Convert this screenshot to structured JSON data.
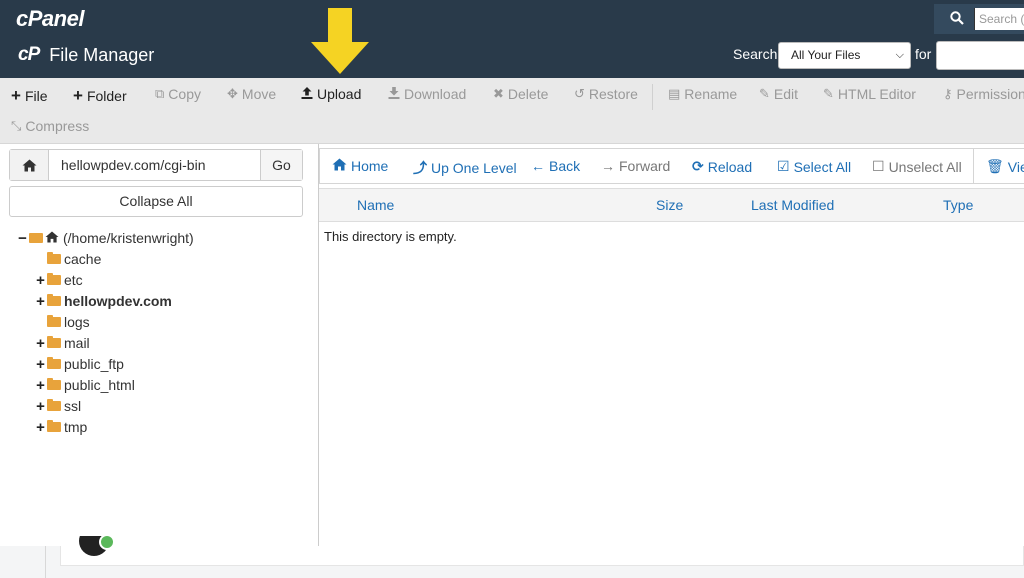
{
  "header": {
    "logo_text": "cPanel",
    "app_icon_text": "cP",
    "app_title": "File Manager",
    "top_search_placeholder": "Search ( /",
    "search_label": "Search",
    "search_scope": "All Your Files",
    "for_label": "for",
    "search_value": ""
  },
  "toolbar": {
    "row1": [
      {
        "label": "File",
        "icon": "+",
        "active": true
      },
      {
        "label": "Folder",
        "icon": "+",
        "active": true
      },
      {
        "label": "Copy",
        "icon": "⧉",
        "active": false
      },
      {
        "label": "Move",
        "icon": "✥",
        "active": false
      },
      {
        "label": "Upload",
        "icon": "⤒",
        "active": true
      },
      {
        "label": "Download",
        "icon": "⤓",
        "active": false
      },
      {
        "label": "Delete",
        "icon": "✖",
        "active": false
      },
      {
        "label": "Restore",
        "icon": "↺",
        "active": false
      },
      {
        "label": "Rename",
        "icon": "▤",
        "active": false
      },
      {
        "label": "Edit",
        "icon": "✎",
        "active": false
      },
      {
        "label": "HTML Editor",
        "icon": "✎",
        "active": false
      },
      {
        "label": "Permissions",
        "icon": "🔑",
        "active": false
      }
    ],
    "compress": {
      "label": "Compress",
      "icon": "✂",
      "active": false
    }
  },
  "left": {
    "path_value": "hellowpdev.com/cgi-bin",
    "go_label": "Go",
    "collapse_label": "Collapse All",
    "root_label": "(/home/kristenwright)",
    "tree": [
      {
        "label": "cache",
        "toggle": "",
        "bold": false
      },
      {
        "label": "etc",
        "toggle": "+",
        "bold": false
      },
      {
        "label": "hellowpdev.com",
        "toggle": "+",
        "bold": true
      },
      {
        "label": "logs",
        "toggle": "",
        "bold": false
      },
      {
        "label": "mail",
        "toggle": "+",
        "bold": false
      },
      {
        "label": "public_ftp",
        "toggle": "+",
        "bold": false
      },
      {
        "label": "public_html",
        "toggle": "+",
        "bold": false
      },
      {
        "label": "ssl",
        "toggle": "+",
        "bold": false
      },
      {
        "label": "tmp",
        "toggle": "+",
        "bold": false
      }
    ]
  },
  "nav": {
    "home": "Home",
    "up": "Up One Level",
    "back": "Back",
    "forward": "Forward",
    "reload": "Reload",
    "select_all": "Select All",
    "unselect_all": "Unselect All",
    "view": "View"
  },
  "columns": {
    "name": "Name",
    "size": "Size",
    "modified": "Last Modified",
    "type": "Type"
  },
  "empty_message": "This directory is empty.",
  "colors": {
    "header_bg": "#293a4a",
    "link_blue": "#1f6fb5",
    "arrow_yellow": "#f5d323",
    "folder": "#e8a33b"
  }
}
